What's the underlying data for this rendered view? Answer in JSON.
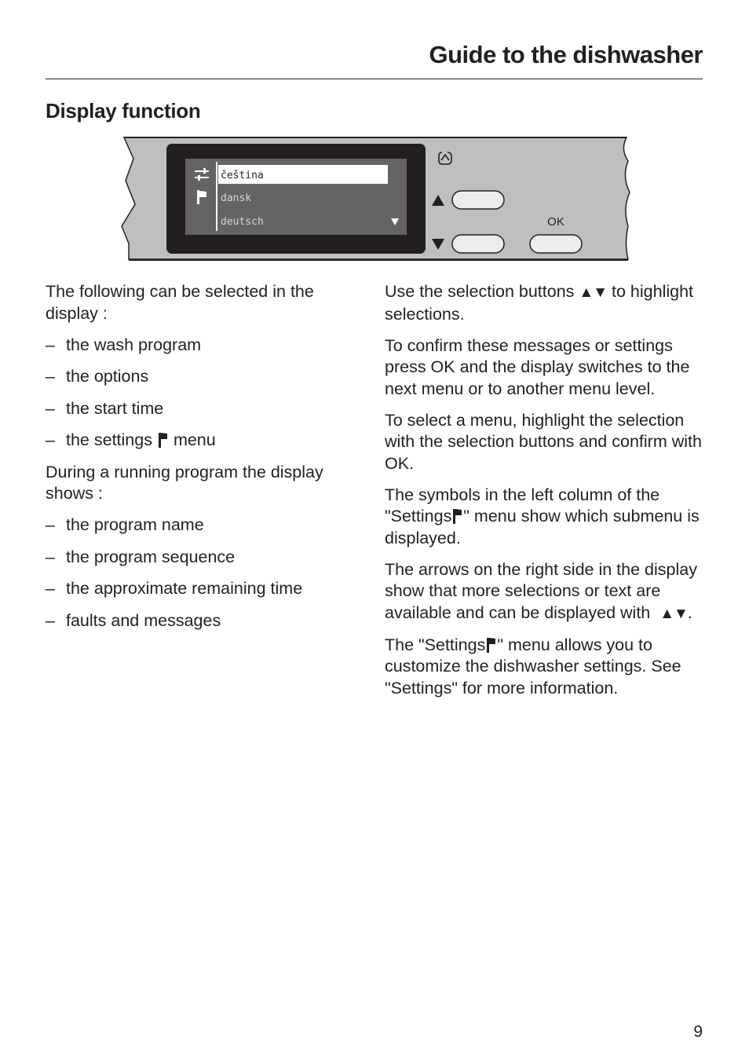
{
  "header": {
    "title": "Guide to the dishwasher"
  },
  "section": {
    "title": "Display function"
  },
  "panel": {
    "display": {
      "icons": [
        "options-icon",
        "flag-icon"
      ],
      "items": [
        {
          "label": "čeština",
          "selected": true
        },
        {
          "label": "dansk",
          "selected": false
        },
        {
          "label": "deutsch",
          "selected": false
        }
      ],
      "scroll_indicator": "▼"
    },
    "buttons": {
      "up_arrow": "▲",
      "down_arrow": "▼",
      "ok_label": "OK"
    },
    "colors": {
      "panel": "#c0bfc0",
      "display_bezel": "#231f20",
      "display_screen": "#646263",
      "highlight": "#ffffff"
    }
  },
  "left_column": {
    "intro": "The following can be selected in the display :",
    "selectable": [
      "the wash program",
      "the options",
      "the start time"
    ],
    "settings_item_before": "the settings",
    "settings_item_after": "menu",
    "running_intro": "During a running program the display shows :",
    "running_items": [
      "the program name",
      "the program sequence",
      "the approximate remaining time",
      "faults and messages"
    ],
    "dash": "–"
  },
  "right_column": {
    "p1_before": "Use the selection buttons",
    "p1_arrows": "▲▼",
    "p1_after": "to highlight selections.",
    "p2": "To confirm these messages or settings press OK and the display switches to the next menu or to another menu level.",
    "p3": "To select a menu, highlight the selection with the selection buttons and confirm with OK.",
    "p4_before": "The symbols in the left column of the \"Settings",
    "p4_after": "\" menu show which submenu is displayed.",
    "p5_before": "The arrows on the right side in the display show that more selections or text are available and can be displayed with",
    "p5_arrows": "▲▼",
    "p5_after": ".",
    "p6_before": "The \"Settings",
    "p6_after": "\" menu allows you to customize the dishwasher settings. See \"Settings\" for more information."
  },
  "footer": {
    "page_number": "9"
  }
}
